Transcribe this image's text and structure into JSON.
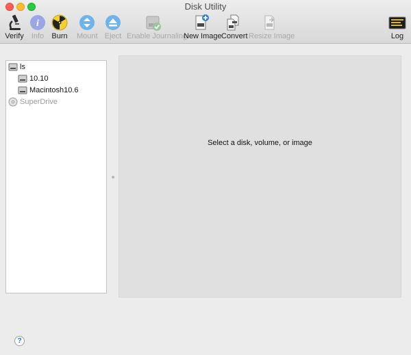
{
  "window": {
    "title": "Disk Utility"
  },
  "toolbar": {
    "items": [
      {
        "label": "Verify",
        "icon": "microscope-icon",
        "enabled": true
      },
      {
        "label": "Info",
        "icon": "info-icon",
        "enabled": false
      },
      {
        "label": "Burn",
        "icon": "radiation-icon",
        "enabled": true
      },
      {
        "label": "Mount",
        "icon": "mount-icon",
        "enabled": false
      },
      {
        "label": "Eject",
        "icon": "eject-icon",
        "enabled": false
      },
      {
        "label": "Enable Journaling",
        "icon": "journaling-disk-icon",
        "enabled": false
      },
      {
        "label": "New Image",
        "icon": "new-image-icon",
        "enabled": true
      },
      {
        "label": "Convert",
        "icon": "convert-icon",
        "enabled": true
      },
      {
        "label": "Resize Image",
        "icon": "resize-image-icon",
        "enabled": false
      },
      {
        "label": "Log",
        "icon": "log-console-icon",
        "enabled": true
      }
    ]
  },
  "sidebar": {
    "items": [
      {
        "label": "ls",
        "icon": "hard-disk-icon",
        "level": 0
      },
      {
        "label": "10.10",
        "icon": "volume-icon",
        "level": 1
      },
      {
        "label": "Macintosh10.6",
        "icon": "volume-icon",
        "level": 1
      },
      {
        "label": "SuperDrive",
        "icon": "optical-drive-icon",
        "level": 0,
        "dimmed": true
      }
    ]
  },
  "main": {
    "message": "Select a disk, volume, or image"
  },
  "help": {
    "symbol": "?"
  },
  "colors": {
    "close": "#fc5f57",
    "minimize": "#fdbc2e",
    "zoom": "#2acb42",
    "disabled_text": "#a8a8a8",
    "panel_bg": "#e0e0e0"
  }
}
